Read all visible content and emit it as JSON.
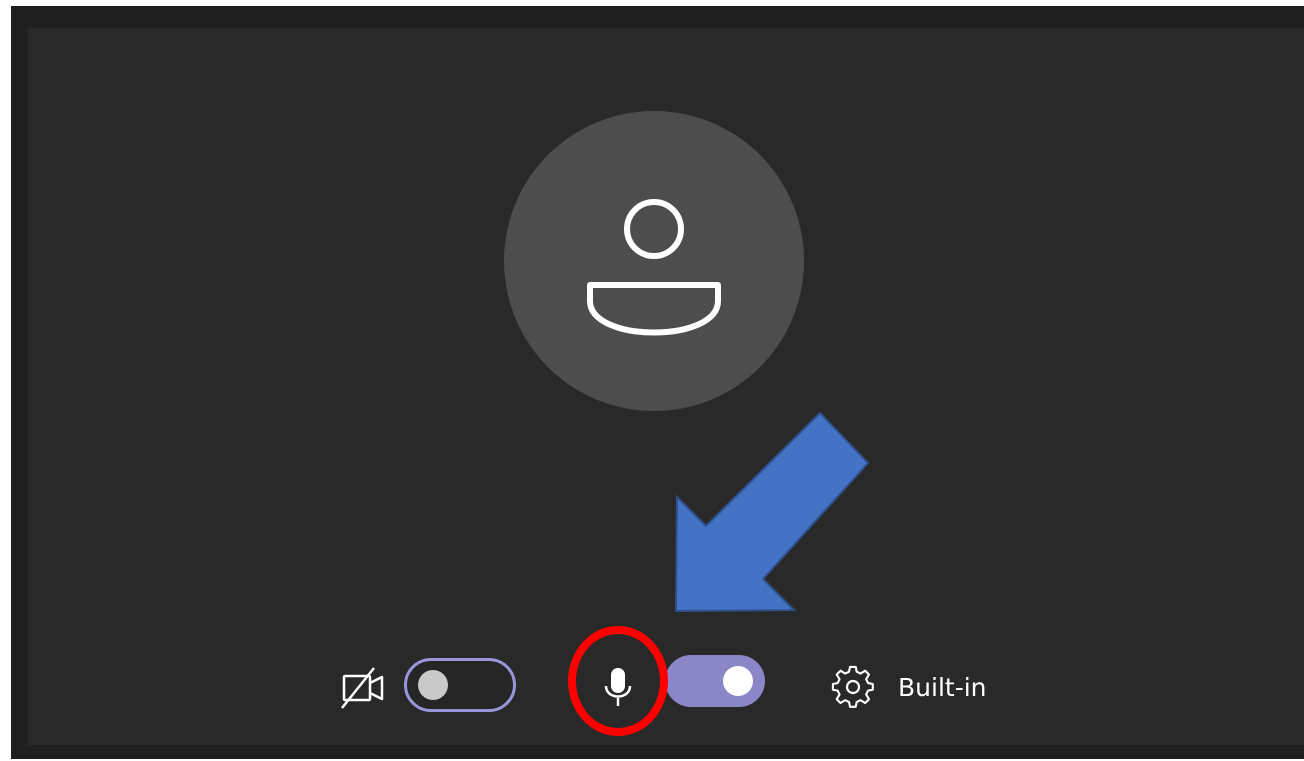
{
  "preview": {
    "avatar_icon": "person-icon",
    "avatar_background": "#4d4d4d"
  },
  "controls": {
    "camera": {
      "icon": "camera-off-icon",
      "state": "off",
      "toggle_border_color": "#9a95d8"
    },
    "microphone": {
      "icon": "mic-icon",
      "state": "on",
      "toggle_color": "#8b86c8"
    },
    "device_settings": {
      "icon": "settings-icon",
      "label": "Built-in"
    }
  },
  "annotations": {
    "arrow_color": "#4472c4",
    "highlight_color": "#ff0000",
    "highlighted_control": "mic-icon"
  }
}
